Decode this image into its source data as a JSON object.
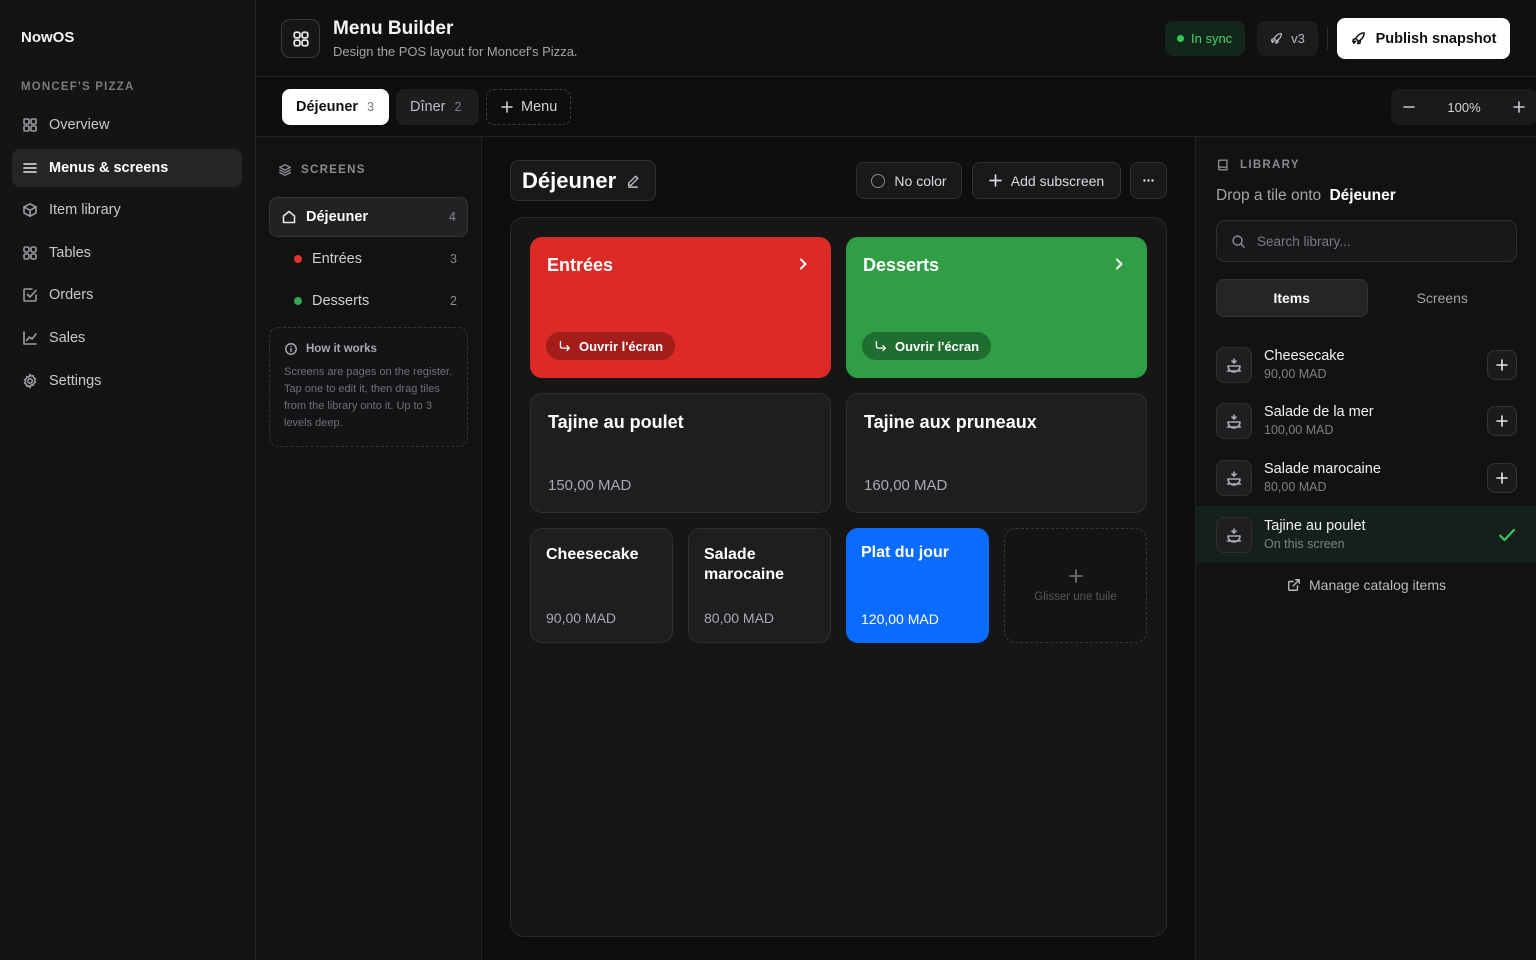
{
  "app": {
    "brand": "NowOS",
    "org": "MONCEF'S PIZZA"
  },
  "nav": [
    {
      "label": "Overview",
      "icon": "grid-icon"
    },
    {
      "label": "Menus & screens",
      "icon": "menu-lines-icon",
      "active": true
    },
    {
      "label": "Item library",
      "icon": "box-icon"
    },
    {
      "label": "Tables",
      "icon": "tables-icon"
    },
    {
      "label": "Orders",
      "icon": "checklist-icon"
    },
    {
      "label": "Sales",
      "icon": "chart-line-icon"
    },
    {
      "label": "Settings",
      "icon": "gear-icon"
    }
  ],
  "header": {
    "title": "Menu Builder",
    "subtitle": "Design the POS layout for Moncef's Pizza.",
    "sync": "In sync",
    "version": "v3",
    "publish": "Publish snapshot"
  },
  "tabs": [
    {
      "label": "Déjeuner",
      "count": "3"
    },
    {
      "label": "Dîner",
      "count": "2"
    }
  ],
  "add_menu": "Menu",
  "zoom": "100%",
  "screens": {
    "title": "SCREENS",
    "root": {
      "label": "Déjeuner",
      "count": "4"
    },
    "children": [
      {
        "label": "Entrées",
        "count": "3",
        "color": "#e5322d"
      },
      {
        "label": "Desserts",
        "count": "2",
        "color": "#34a853"
      }
    ],
    "howto_title": "How it works",
    "howto_body": "Screens are pages on the register. Tap one to edit it, then drag tiles from the library onto it. Up to 3 levels deep."
  },
  "canvas": {
    "title": "Déjeuner",
    "color_btn": "No color",
    "add_sub": "Add subscreen",
    "tiles": {
      "sub1": {
        "name": "Entrées",
        "open": "Ouvrir l'écran",
        "color": "#dc2a26",
        "pill": "#a31d1b"
      },
      "sub2": {
        "name": "Desserts",
        "open": "Ouvrir l'écran",
        "color": "#2f9e44",
        "pill": "#1f6e2f"
      },
      "item1": {
        "name": "Tajine au poulet",
        "price": "150,00 MAD"
      },
      "item2": {
        "name": "Tajine aux pruneaux",
        "price": "160,00 MAD"
      },
      "item3": {
        "name": "Cheesecake",
        "price": "90,00 MAD"
      },
      "item4": {
        "name": "Salade marocaine",
        "price": "80,00 MAD"
      },
      "item5": {
        "name": "Plat du jour",
        "price": "120,00 MAD",
        "color": "#0a6cff"
      },
      "drop": "Glisser une tuile"
    }
  },
  "library": {
    "title": "LIBRARY",
    "drop_prefix": "Drop a tile onto",
    "drop_target": "Déjeuner",
    "search_placeholder": "Search library...",
    "seg_items": "Items",
    "seg_screens": "Screens",
    "items": [
      {
        "name": "Cheesecake",
        "sub": "90,00 MAD"
      },
      {
        "name": "Salade de la mer",
        "sub": "100,00 MAD"
      },
      {
        "name": "Salade marocaine",
        "sub": "80,00 MAD"
      },
      {
        "name": "Tajine au poulet",
        "sub": "On this screen"
      }
    ],
    "manage": "Manage catalog items"
  }
}
